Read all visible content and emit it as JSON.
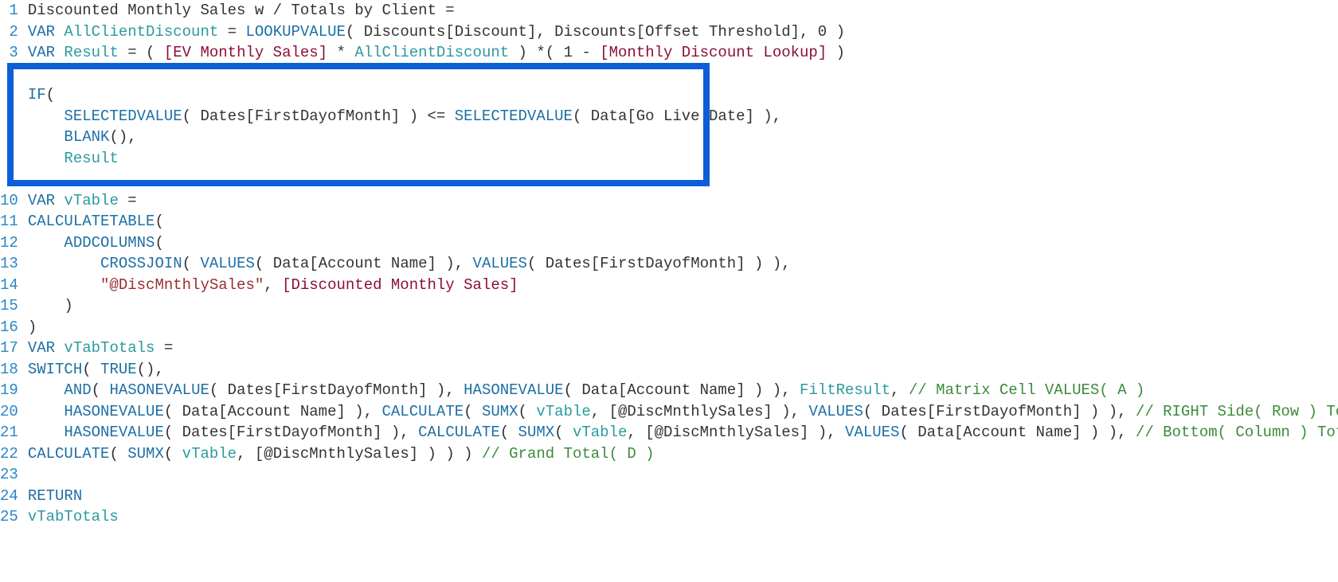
{
  "chart_data": null,
  "gutter": [
    "1",
    "2",
    "3",
    "",
    "",
    "",
    "",
    "",
    "",
    "10",
    "11",
    "12",
    "13",
    "14",
    "15",
    "16",
    "17",
    "18",
    "19",
    "20",
    "21",
    "22",
    "23",
    "24",
    "25"
  ],
  "lines": {
    "l1": {
      "a": "Discounted Monthly Sales w / Totals by Client ="
    },
    "l2": {
      "a": "VAR",
      "b": " AllClientDiscount ",
      "c": "= ",
      "d": "LOOKUPVALUE",
      "e": "( Discounts[Discount], Discounts[Offset Threshold], 0 )"
    },
    "l3": {
      "a": "VAR",
      "b": " Result ",
      "c": "= ( ",
      "d": "[EV Monthly Sales]",
      "e": " * ",
      "f": "AllClientDiscount",
      "g": " ) *( 1 - ",
      "h": "[Monthly Discount Lookup]",
      "i": " )"
    },
    "l5": {
      "a": "IF",
      "b": "("
    },
    "l6": {
      "a": "    ",
      "b": "SELECTEDVALUE",
      "c": "( Dates[FirstDayofMonth] ) <= ",
      "d": "SELECTEDVALUE",
      "e": "( Data[Go Live Date] ),"
    },
    "l7": {
      "a": "    ",
      "b": "BLANK",
      "c": "(),"
    },
    "l8": {
      "a": "    ",
      "b": "Result"
    },
    "l10": {
      "a": "VAR",
      "b": " vTable ",
      "c": "="
    },
    "l11": {
      "a": "CALCULATETABLE",
      "b": "("
    },
    "l12": {
      "a": "    ",
      "b": "ADDCOLUMNS",
      "c": "("
    },
    "l13": {
      "a": "        ",
      "b": "CROSSJOIN",
      "c": "( ",
      "d": "VALUES",
      "e": "( Data[Account Name] ), ",
      "f": "VALUES",
      "g": "( Dates[FirstDayofMonth] ) ),"
    },
    "l14": {
      "a": "        ",
      "b": "\"@DiscMnthlySales\"",
      "c": ", ",
      "d": "[Discounted Monthly Sales]"
    },
    "l15": {
      "a": "    )"
    },
    "l16": {
      "a": ")"
    },
    "l17": {
      "a": "VAR",
      "b": " vTabTotals ",
      "c": "="
    },
    "l18": {
      "a": "SWITCH",
      "b": "( ",
      "c": "TRUE",
      "d": "(),"
    },
    "l19": {
      "a": "    ",
      "b": "AND",
      "c": "( ",
      "d": "HASONEVALUE",
      "e": "( Dates[FirstDayofMonth] ), ",
      "f": "HASONEVALUE",
      "g": "( Data[Account Name] ) ), ",
      "h": "FiltResult",
      "i": ", ",
      "j": "// Matrix Cell VALUES( A )"
    },
    "l20": {
      "a": "    ",
      "b": "HASONEVALUE",
      "c": "( Data[Account Name] ), ",
      "d": "CALCULATE",
      "e": "( ",
      "f": "SUMX",
      "g": "( ",
      "h": "vTable",
      "i": ", [@DiscMnthlySales] ), ",
      "j": "VALUES",
      "k": "( Dates[FirstDayofMonth] ) ), ",
      "l": "// RIGHT Side( Row ) Totals( B )"
    },
    "l21": {
      "a": "    ",
      "b": "HASONEVALUE",
      "c": "( Dates[FirstDayofMonth] ), ",
      "d": "CALCULATE",
      "e": "( ",
      "f": "SUMX",
      "g": "( ",
      "h": "vTable",
      "i": ", [@DiscMnthlySales] ), ",
      "j": "VALUES",
      "k": "( Data[Account Name] ) ), ",
      "l": "// Bottom( Column ) Totals( C )"
    },
    "l22": {
      "a": "CALCULATE",
      "b": "( ",
      "c": "SUMX",
      "d": "( ",
      "e": "vTable",
      "f": ", [@DiscMnthlySales] ) ) ) ",
      "g": "// Grand Total( D )"
    },
    "l24": {
      "a": "RETURN"
    },
    "l25": {
      "a": "vTabTotals"
    }
  }
}
